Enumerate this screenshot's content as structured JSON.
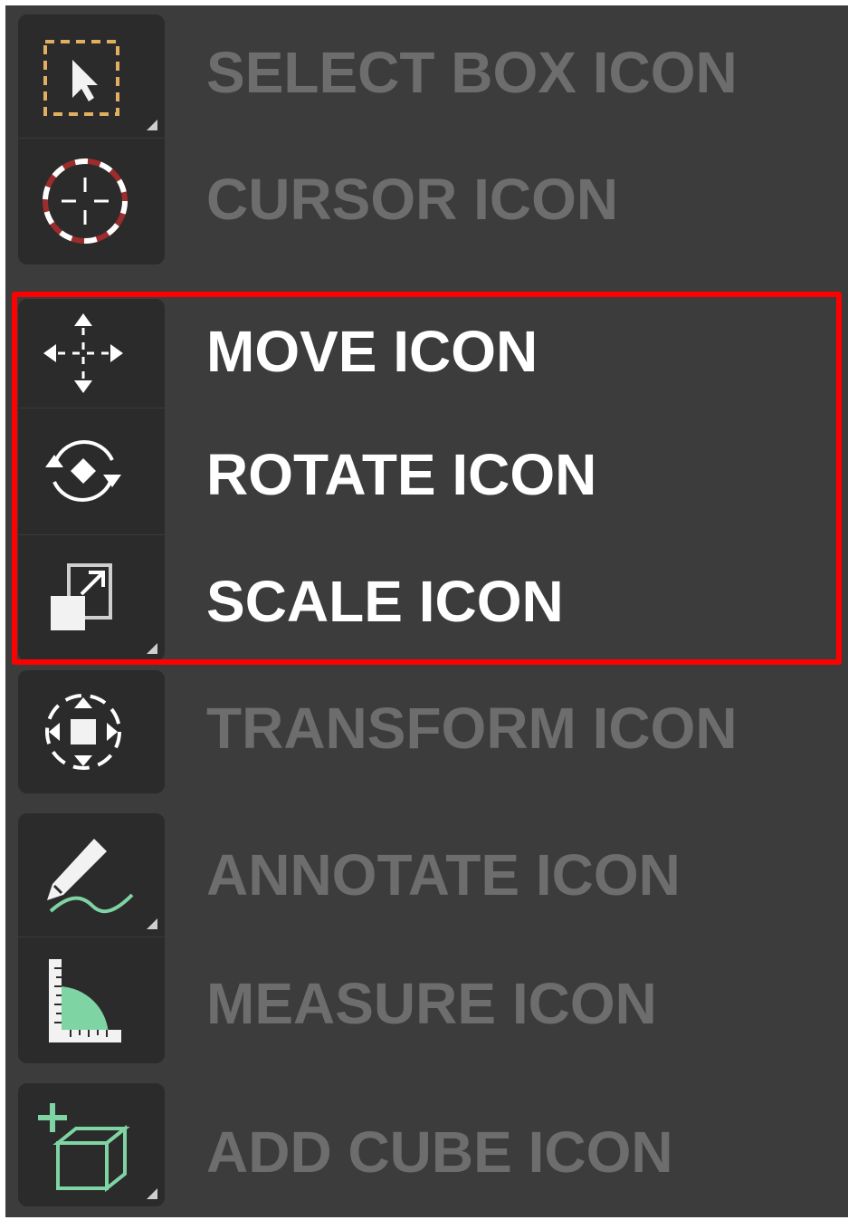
{
  "toolbar": {
    "items": [
      {
        "label": "SELECT BOX ICON",
        "icon": "select-box-icon"
      },
      {
        "label": "CURSOR ICON",
        "icon": "cursor-icon"
      },
      {
        "label": "MOVE ICON",
        "icon": "move-icon"
      },
      {
        "label": "ROTATE ICON",
        "icon": "rotate-icon"
      },
      {
        "label": "SCALE ICON",
        "icon": "scale-icon"
      },
      {
        "label": "TRANSFORM ICON",
        "icon": "transform-icon"
      },
      {
        "label": "ANNOTATE ICON",
        "icon": "annotate-icon"
      },
      {
        "label": "MEASURE ICON",
        "icon": "measure-icon"
      },
      {
        "label": "ADD CUBE ICON",
        "icon": "add-cube-icon"
      }
    ]
  },
  "colors": {
    "panel_bg": "#3c3c3c",
    "button_bg": "#2b2b2b",
    "label_dim": "#6d6d6d",
    "label_highlight": "#ffffff",
    "highlight_border": "#ff0000",
    "select_accent": "#e0b060",
    "cursor_accent": "#9b2d2d",
    "green_accent": "#7fd4a4"
  }
}
